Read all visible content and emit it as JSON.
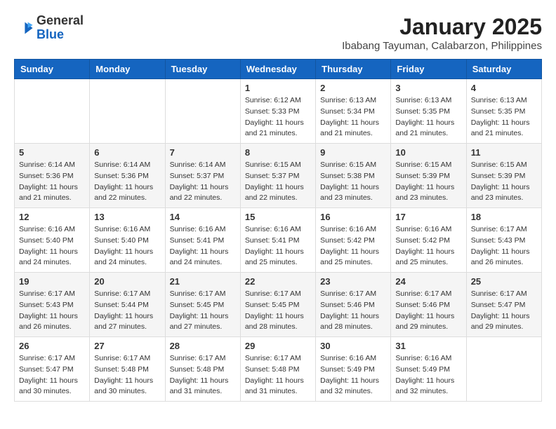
{
  "header": {
    "logo_line1": "General",
    "logo_line2": "Blue",
    "month": "January 2025",
    "location": "Ibabang Tayuman, Calabarzon, Philippines"
  },
  "days_of_week": [
    "Sunday",
    "Monday",
    "Tuesday",
    "Wednesday",
    "Thursday",
    "Friday",
    "Saturday"
  ],
  "weeks": [
    [
      {
        "day": "",
        "info": ""
      },
      {
        "day": "",
        "info": ""
      },
      {
        "day": "",
        "info": ""
      },
      {
        "day": "1",
        "info": "Sunrise: 6:12 AM\nSunset: 5:33 PM\nDaylight: 11 hours\nand 21 minutes."
      },
      {
        "day": "2",
        "info": "Sunrise: 6:13 AM\nSunset: 5:34 PM\nDaylight: 11 hours\nand 21 minutes."
      },
      {
        "day": "3",
        "info": "Sunrise: 6:13 AM\nSunset: 5:35 PM\nDaylight: 11 hours\nand 21 minutes."
      },
      {
        "day": "4",
        "info": "Sunrise: 6:13 AM\nSunset: 5:35 PM\nDaylight: 11 hours\nand 21 minutes."
      }
    ],
    [
      {
        "day": "5",
        "info": "Sunrise: 6:14 AM\nSunset: 5:36 PM\nDaylight: 11 hours\nand 21 minutes."
      },
      {
        "day": "6",
        "info": "Sunrise: 6:14 AM\nSunset: 5:36 PM\nDaylight: 11 hours\nand 22 minutes."
      },
      {
        "day": "7",
        "info": "Sunrise: 6:14 AM\nSunset: 5:37 PM\nDaylight: 11 hours\nand 22 minutes."
      },
      {
        "day": "8",
        "info": "Sunrise: 6:15 AM\nSunset: 5:37 PM\nDaylight: 11 hours\nand 22 minutes."
      },
      {
        "day": "9",
        "info": "Sunrise: 6:15 AM\nSunset: 5:38 PM\nDaylight: 11 hours\nand 23 minutes."
      },
      {
        "day": "10",
        "info": "Sunrise: 6:15 AM\nSunset: 5:39 PM\nDaylight: 11 hours\nand 23 minutes."
      },
      {
        "day": "11",
        "info": "Sunrise: 6:15 AM\nSunset: 5:39 PM\nDaylight: 11 hours\nand 23 minutes."
      }
    ],
    [
      {
        "day": "12",
        "info": "Sunrise: 6:16 AM\nSunset: 5:40 PM\nDaylight: 11 hours\nand 24 minutes."
      },
      {
        "day": "13",
        "info": "Sunrise: 6:16 AM\nSunset: 5:40 PM\nDaylight: 11 hours\nand 24 minutes."
      },
      {
        "day": "14",
        "info": "Sunrise: 6:16 AM\nSunset: 5:41 PM\nDaylight: 11 hours\nand 24 minutes."
      },
      {
        "day": "15",
        "info": "Sunrise: 6:16 AM\nSunset: 5:41 PM\nDaylight: 11 hours\nand 25 minutes."
      },
      {
        "day": "16",
        "info": "Sunrise: 6:16 AM\nSunset: 5:42 PM\nDaylight: 11 hours\nand 25 minutes."
      },
      {
        "day": "17",
        "info": "Sunrise: 6:16 AM\nSunset: 5:42 PM\nDaylight: 11 hours\nand 25 minutes."
      },
      {
        "day": "18",
        "info": "Sunrise: 6:17 AM\nSunset: 5:43 PM\nDaylight: 11 hours\nand 26 minutes."
      }
    ],
    [
      {
        "day": "19",
        "info": "Sunrise: 6:17 AM\nSunset: 5:43 PM\nDaylight: 11 hours\nand 26 minutes."
      },
      {
        "day": "20",
        "info": "Sunrise: 6:17 AM\nSunset: 5:44 PM\nDaylight: 11 hours\nand 27 minutes."
      },
      {
        "day": "21",
        "info": "Sunrise: 6:17 AM\nSunset: 5:45 PM\nDaylight: 11 hours\nand 27 minutes."
      },
      {
        "day": "22",
        "info": "Sunrise: 6:17 AM\nSunset: 5:45 PM\nDaylight: 11 hours\nand 28 minutes."
      },
      {
        "day": "23",
        "info": "Sunrise: 6:17 AM\nSunset: 5:46 PM\nDaylight: 11 hours\nand 28 minutes."
      },
      {
        "day": "24",
        "info": "Sunrise: 6:17 AM\nSunset: 5:46 PM\nDaylight: 11 hours\nand 29 minutes."
      },
      {
        "day": "25",
        "info": "Sunrise: 6:17 AM\nSunset: 5:47 PM\nDaylight: 11 hours\nand 29 minutes."
      }
    ],
    [
      {
        "day": "26",
        "info": "Sunrise: 6:17 AM\nSunset: 5:47 PM\nDaylight: 11 hours\nand 30 minutes."
      },
      {
        "day": "27",
        "info": "Sunrise: 6:17 AM\nSunset: 5:48 PM\nDaylight: 11 hours\nand 30 minutes."
      },
      {
        "day": "28",
        "info": "Sunrise: 6:17 AM\nSunset: 5:48 PM\nDaylight: 11 hours\nand 31 minutes."
      },
      {
        "day": "29",
        "info": "Sunrise: 6:17 AM\nSunset: 5:48 PM\nDaylight: 11 hours\nand 31 minutes."
      },
      {
        "day": "30",
        "info": "Sunrise: 6:16 AM\nSunset: 5:49 PM\nDaylight: 11 hours\nand 32 minutes."
      },
      {
        "day": "31",
        "info": "Sunrise: 6:16 AM\nSunset: 5:49 PM\nDaylight: 11 hours\nand 32 minutes."
      },
      {
        "day": "",
        "info": ""
      }
    ]
  ]
}
